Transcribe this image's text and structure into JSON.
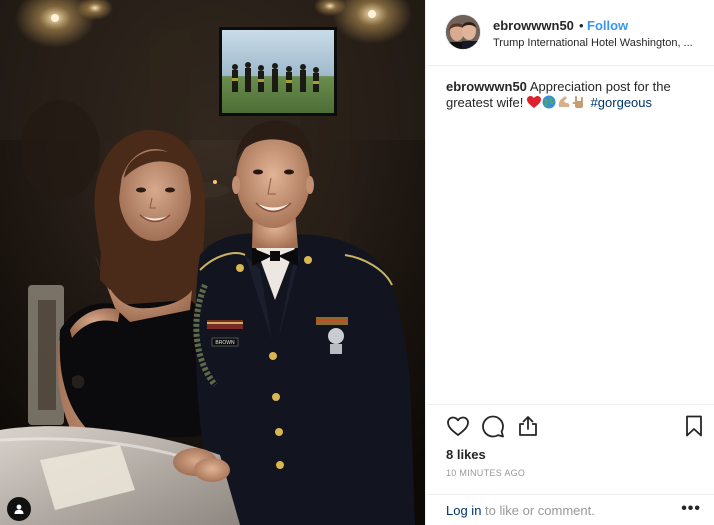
{
  "post": {
    "username": "ebrowwwn50",
    "follow_label": "Follow",
    "separator": "•",
    "location": "Trump International Hotel Washington, ...",
    "caption": {
      "username": "ebrowwwn50",
      "text": "Appreciation post for the greatest wife!",
      "emojis": [
        "red-heart",
        "globe",
        "flexed-biceps",
        "love-you-gesture"
      ],
      "hashtag": "#gorgeous"
    },
    "likes": "8 likes",
    "time": "10 MINUTES AGO",
    "login_link": "Log in",
    "login_rest": "to like or comment.",
    "more": "•••"
  },
  "photo": {
    "name_plate": "BROWN"
  },
  "icons": {
    "like": "heart-outline-icon",
    "comment": "comment-bubble-icon",
    "share": "share-icon",
    "save": "bookmark-icon",
    "tag": "person-tag-icon"
  },
  "colors": {
    "link_blue": "#3897f0",
    "hashtag_blue": "#003569",
    "text": "#262626",
    "muted": "#999999",
    "divider": "#efefef"
  }
}
